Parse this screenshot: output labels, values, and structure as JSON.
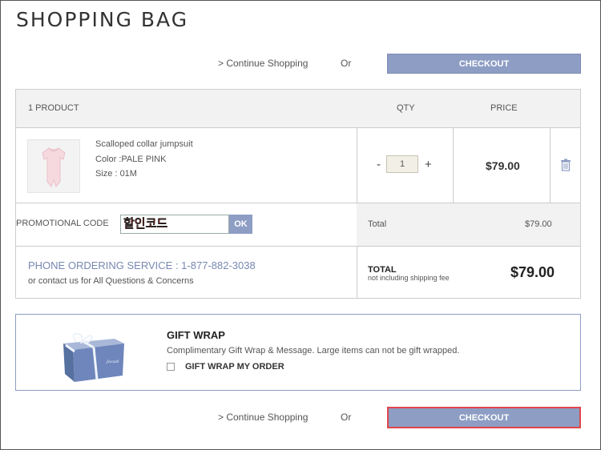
{
  "page": {
    "title": "SHOPPING BAG"
  },
  "nav_top": {
    "continue": "> Continue Shopping",
    "or": "Or",
    "checkout": "CHECKOUT"
  },
  "cart": {
    "header": {
      "product_count": "1 PRODUCT",
      "qty": "QTY",
      "price": "PRICE"
    },
    "item": {
      "name": "Scalloped collar jumpsuit",
      "color": "Color :PALE PINK",
      "size": "Size : 01M",
      "qty_minus": "-",
      "qty_value": "1",
      "qty_plus": "+",
      "price": "$79.00",
      "delete_icon": "trash-icon"
    },
    "promo": {
      "label": "PROMOTIONAL CODE",
      "value": "할인코드",
      "ok": "OK"
    },
    "total": {
      "label": "Total",
      "value": "$79.00"
    },
    "phone": {
      "service": "PHONE ORDERING SERVICE : 1-877-882-3038",
      "contact": "or contact us for All Questions & Concerns"
    },
    "grand_total": {
      "label": "TOTAL",
      "note": "not including shipping fee",
      "value": "$79.00"
    }
  },
  "gift": {
    "image_icon": "gift-box-icon",
    "title": "GIFT WRAP",
    "description": "Complimentary Gift Wrap & Message. Large items can not be gift wrapped.",
    "checkbox_label": "GIFT WRAP MY ORDER",
    "checked": false
  },
  "nav_bottom": {
    "continue": "> Continue Shopping",
    "or": "Or",
    "checkout": "CHECKOUT"
  },
  "colors": {
    "accent": "#8d9dc4",
    "highlight": "#e0464c",
    "promo_text": "#e0201b"
  }
}
